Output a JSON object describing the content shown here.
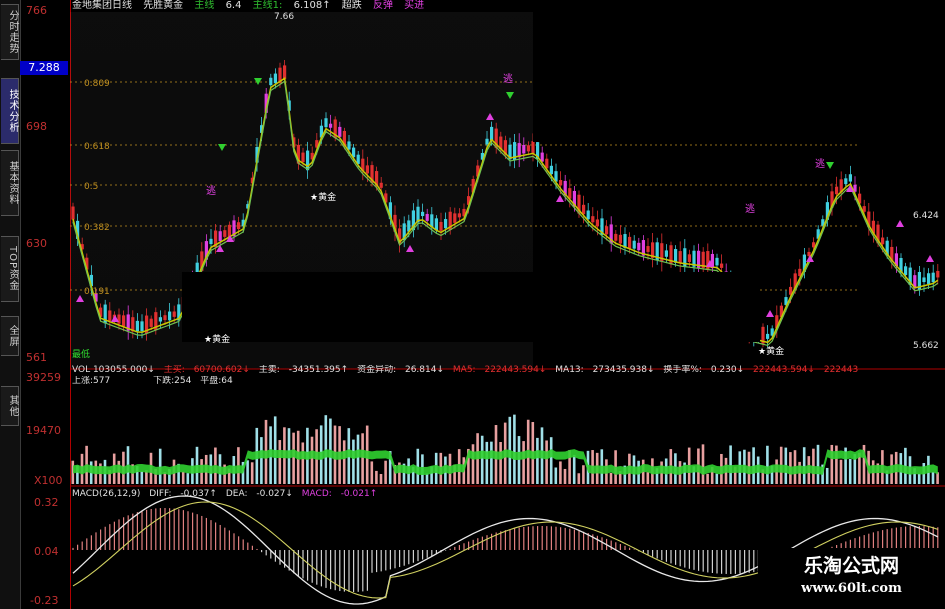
{
  "tabs": [
    {
      "label": "分时走势",
      "active": false
    },
    {
      "label": "技术分析",
      "active": true
    },
    {
      "label": "基本资料",
      "active": false
    },
    {
      "label": "TOP资金",
      "active": false
    },
    {
      "label": "全屏",
      "active": false
    },
    {
      "label": "其他",
      "active": false
    }
  ],
  "current_price": "7.288",
  "title": {
    "stock": "金地集团日线",
    "formula": "先胜黄金",
    "main_label": "主线",
    "main_value": "6.4",
    "main1_label": "主线1:",
    "main1_value": "6.108↑",
    "super_drop": "超跌",
    "rebound": "反弹",
    "buy": "买进"
  },
  "price_axis": {
    "labels": [
      "766",
      "698",
      "630",
      "561"
    ],
    "fib_labels": [
      "0.809",
      "0.618",
      "0.5",
      "0.382",
      "0.191"
    ],
    "right_labels": [
      "6.424",
      "5.662"
    ],
    "high_label": "7.66",
    "low_label": "最低",
    "signal_text": "★黄金",
    "flag_text": "逃"
  },
  "colors": {
    "up": "#e03030",
    "down": "#40d0e0",
    "ma_main": "#c8c800",
    "ma_alt": "#70c050",
    "fib": "#c09020",
    "axis": "#b00000",
    "magenta": "#e040e0"
  },
  "volume": {
    "axis_labels": [
      "39259",
      "19470",
      "X100"
    ],
    "info": {
      "vol": "VOL 103055.000↓",
      "main_buy_label": "主买:",
      "main_buy": "60700.602↓",
      "main_sell_label": "主卖:",
      "main_sell": "-34351.395↑",
      "flow_label": "资金异动:",
      "flow": "26.814↓",
      "ma5_label": "MA5:",
      "ma5": "222443.594↓",
      "ma13_label": "MA13:",
      "ma13": "273435.938↓",
      "turnover_label": "换手率%:",
      "turnover": "0.230↓",
      "extra1": "222443.594↓",
      "extra2": "222443"
    },
    "sub": {
      "up": "上涨:577",
      "down": "下跌:254",
      "flat": "平盘:64"
    }
  },
  "macd": {
    "axis_labels": [
      "0.32",
      "0.04",
      "-0.23"
    ],
    "info": {
      "name": "MACD(26,12,9)",
      "diff_label": "DIFF:",
      "diff": "-0.037↑",
      "dea_label": "DEA:",
      "dea": "-0.027↓",
      "macd_label": "MACD:",
      "macd": "-0.021↑"
    }
  },
  "watermark": {
    "line1": "乐淘公式网",
    "line2": "www.60lt.com"
  }
}
